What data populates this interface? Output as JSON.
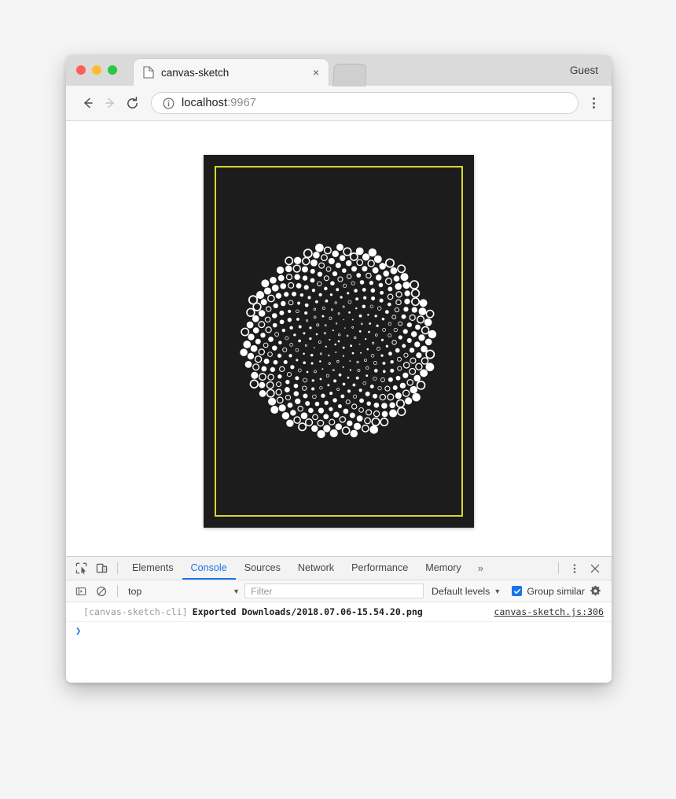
{
  "window": {
    "traffic_lights": [
      {
        "name": "close",
        "color": "#ff5f57"
      },
      {
        "name": "minimize",
        "color": "#febc2e"
      },
      {
        "name": "maximize",
        "color": "#28c840"
      }
    ],
    "profile_label": "Guest"
  },
  "tabs": {
    "active": {
      "title": "canvas-sketch",
      "favicon_icon": "page-icon",
      "close_icon": "close-icon",
      "close_glyph": "×"
    },
    "new_tab_stub": ""
  },
  "toolbar": {
    "back_icon": "back-arrow-icon",
    "forward_icon": "forward-arrow-icon",
    "reload_icon": "reload-icon",
    "info_icon": "info-circle-icon",
    "url_host": "localhost",
    "url_port": ":9967",
    "menu_icon": "kebab-menu-icon"
  },
  "page": {
    "canvas": {
      "background_color": "#1c1c1c",
      "frame_color": "#d8d832",
      "dot_color": "#ffffff",
      "pattern": "phyllotaxis-dots"
    }
  },
  "devtools": {
    "inspect_icon": "inspect-element-icon",
    "device_icon": "device-toolbar-icon",
    "tabs": [
      {
        "label": "Elements",
        "selected": false
      },
      {
        "label": "Console",
        "selected": true
      },
      {
        "label": "Sources",
        "selected": false
      },
      {
        "label": "Network",
        "selected": false
      },
      {
        "label": "Performance",
        "selected": false
      },
      {
        "label": "Memory",
        "selected": false
      }
    ],
    "overflow_glyph": "»",
    "more_icon": "kebab-menu-icon",
    "close_icon": "close-icon",
    "close_glyph": "✕",
    "filterbar": {
      "sidebar_icon": "console-sidebar-icon",
      "clear_icon": "clear-console-icon",
      "context_value": "top",
      "context_caret": "▼",
      "filter_placeholder": "Filter",
      "filter_value": "",
      "levels_value": "Default levels",
      "levels_caret": "▼",
      "group_similar_label": "Group similar",
      "group_similar_checked": true,
      "checkbox_color": "#1a73e8",
      "settings_icon": "gear-icon"
    },
    "console": {
      "messages": [
        {
          "prefix": "[canvas-sketch-cli]",
          "text": "Exported Downloads/2018.07.06-15.54.20.png",
          "source": "canvas-sketch.js:306"
        }
      ],
      "prompt_glyph": "❯"
    }
  }
}
